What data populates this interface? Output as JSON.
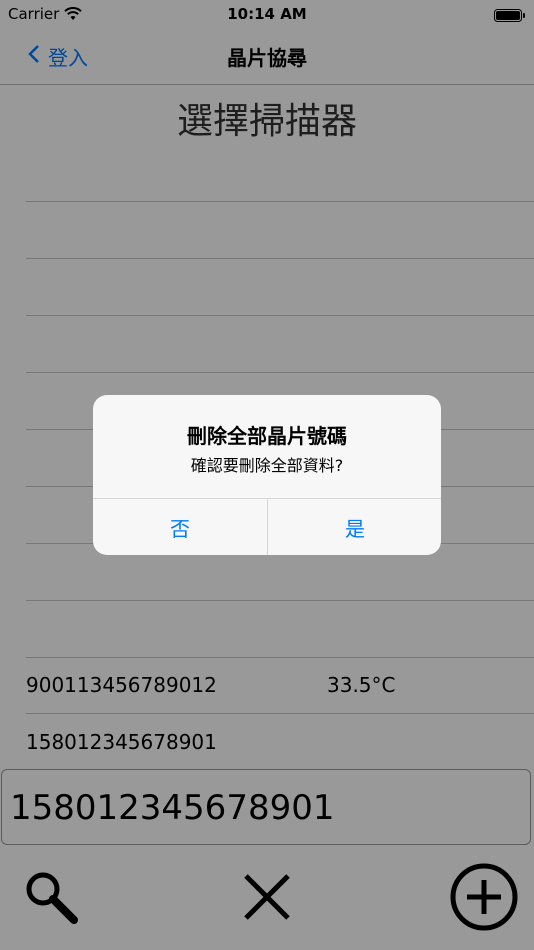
{
  "status_bar": {
    "carrier": "Carrier",
    "time": "10:14 AM"
  },
  "navbar": {
    "back_label": "登入",
    "title": "晶片協尋"
  },
  "page": {
    "heading": "選擇掃描器"
  },
  "records": [
    {
      "chip_id": "900113456789012",
      "temperature": "33.5°C"
    },
    {
      "chip_id": "158012345678901",
      "temperature": ""
    }
  ],
  "input": {
    "value": "158012345678901"
  },
  "toolbar": {
    "search_icon": "magnifier",
    "clear_icon": "x-mark",
    "add_icon": "circle-plus"
  },
  "alert": {
    "title": "刪除全部晶片號碼",
    "message": "確認要刪除全部資料?",
    "no_label": "否",
    "yes_label": "是"
  },
  "colors": {
    "accent": "#007aff",
    "dim_overlay": "rgba(0,0,0,0.4)"
  }
}
